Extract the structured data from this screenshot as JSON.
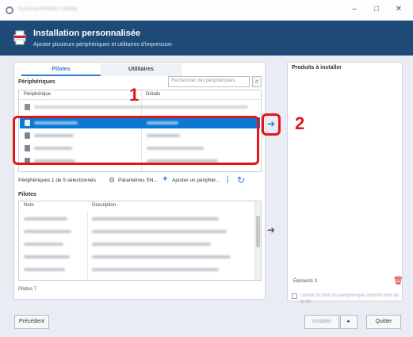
{
  "window": {
    "title": "Kyocera Product Library",
    "minimize": "–",
    "maximize": "□",
    "close": "✕"
  },
  "header": {
    "title": "Installation personnalisée",
    "subtitle": "Ajouter plusieurs périphériques et utilitaires d'impression"
  },
  "tabs": [
    {
      "label": "Pilotes",
      "active": true
    },
    {
      "label": "Utilitaires",
      "active": false
    }
  ],
  "devices": {
    "section_label": "Périphériques",
    "search_placeholder": "Rechercher des périphériques",
    "columns": [
      "Périphérique",
      "Détails"
    ],
    "first_row_text": "Se connecter au périphérique de l'imprimante USB Ajouter périphérique ou IP",
    "selected_rows": 4,
    "first_selected_index": 0,
    "status": "Périphériques 1 de 5 sélectionnés",
    "snmp_label": "Paramètres SN...",
    "add_label": "Ajouter un périphér..."
  },
  "drivers": {
    "section_label": "Pilotes",
    "columns": [
      "Nom",
      "Description"
    ],
    "count_label": "Pilotes 7"
  },
  "products": {
    "title": "Produits à installer",
    "count_label": "Éléments 0",
    "checkbox_label": "Utiliser le nom du périphérique comme nom de la file"
  },
  "callouts": [
    "1",
    "2"
  ],
  "buttons": {
    "back": "Précédent",
    "install": "Installer",
    "next": "▸",
    "quit": "Quitter"
  },
  "colors": {
    "header_bg": "#1e4a78",
    "selection": "#0a78d4",
    "callout_red": "#e3141c",
    "accent_blue": "#2d7bd3"
  }
}
